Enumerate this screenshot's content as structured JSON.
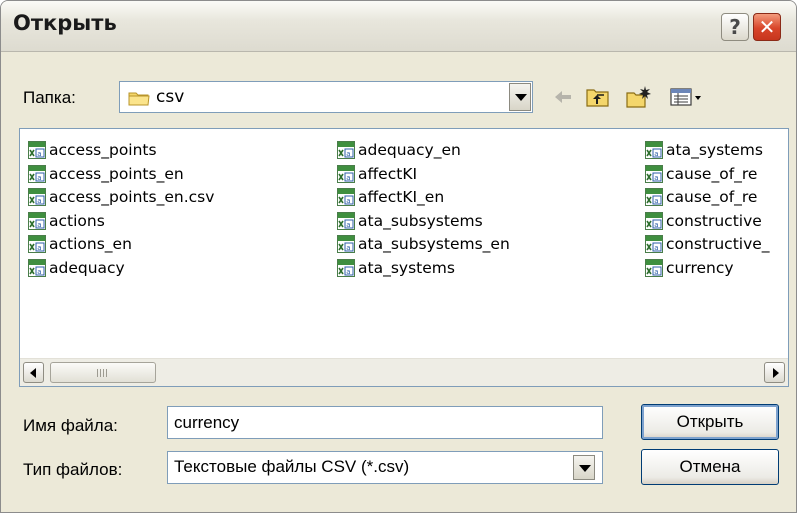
{
  "window": {
    "title": "Открыть",
    "help_label": "?",
    "close_label": "✕"
  },
  "folder": {
    "label": "Папка:",
    "value": "csv"
  },
  "files": {
    "columns": [
      [
        "access_points",
        "access_points_en",
        "access_points_en.csv",
        "actions",
        "actions_en",
        "adequacy"
      ],
      [
        "adequacy_en",
        "affectKI",
        "affectKI_en",
        "ata_subsystems",
        "ata_subsystems_en",
        "ata_systems"
      ],
      [
        "ata_systems",
        "cause_of_re",
        "cause_of_re",
        "constructive",
        "constructive_",
        "currency"
      ]
    ]
  },
  "filename": {
    "label": "Имя файла:",
    "value": "currency"
  },
  "filetype": {
    "label": "Тип файлов:",
    "value": "Текстовые файлы CSV (*.csv)"
  },
  "buttons": {
    "open": "Открыть",
    "cancel": "Отмена"
  },
  "colors": {
    "dialog_bg": "#ece9d8",
    "close_red": "#d8452a",
    "field_border": "#7f9db9",
    "default_button_border": "#003c74"
  },
  "icons": {
    "folder": "folder-icon",
    "back": "back-arrow-icon",
    "up": "up-folder-icon",
    "new_folder": "new-folder-icon",
    "view": "view-menu-icon",
    "file": "csv-file-icon"
  }
}
